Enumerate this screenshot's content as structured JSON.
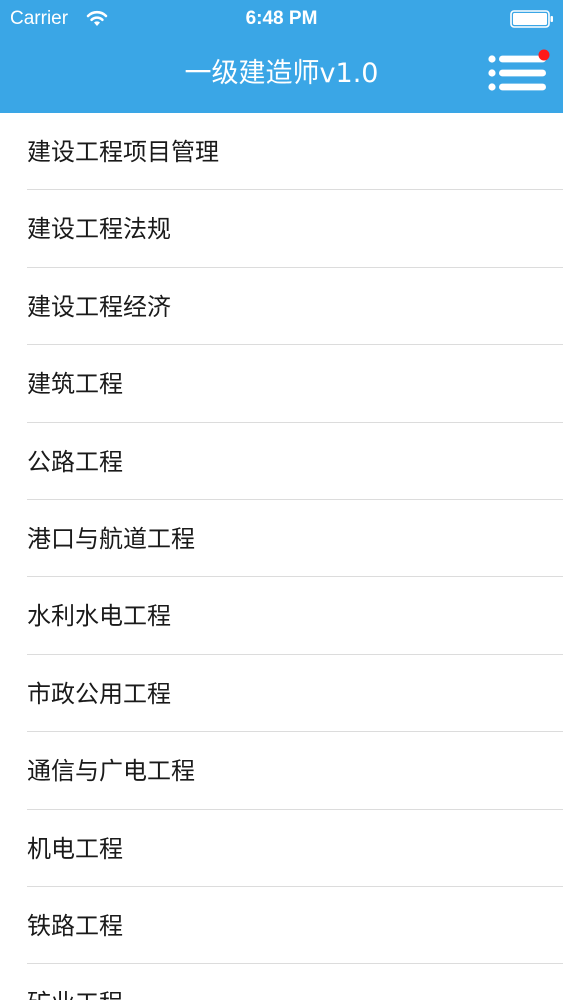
{
  "status_bar": {
    "carrier": "Carrier",
    "time": "6:48 PM",
    "wifi_icon": "wifi-icon",
    "battery_icon": "battery-icon"
  },
  "nav_bar": {
    "title": "一级建造师v1.0",
    "menu_icon": "hamburger-menu-icon",
    "badge_color": "#ff1a1a",
    "background": "#3aa6e6"
  },
  "categories": [
    {
      "label": "建设工程项目管理"
    },
    {
      "label": "建设工程法规"
    },
    {
      "label": "建设工程经济"
    },
    {
      "label": "建筑工程"
    },
    {
      "label": "公路工程"
    },
    {
      "label": "港口与航道工程"
    },
    {
      "label": "水利水电工程"
    },
    {
      "label": "市政公用工程"
    },
    {
      "label": "通信与广电工程"
    },
    {
      "label": "机电工程"
    },
    {
      "label": "铁路工程"
    },
    {
      "label": "矿业工程"
    }
  ]
}
